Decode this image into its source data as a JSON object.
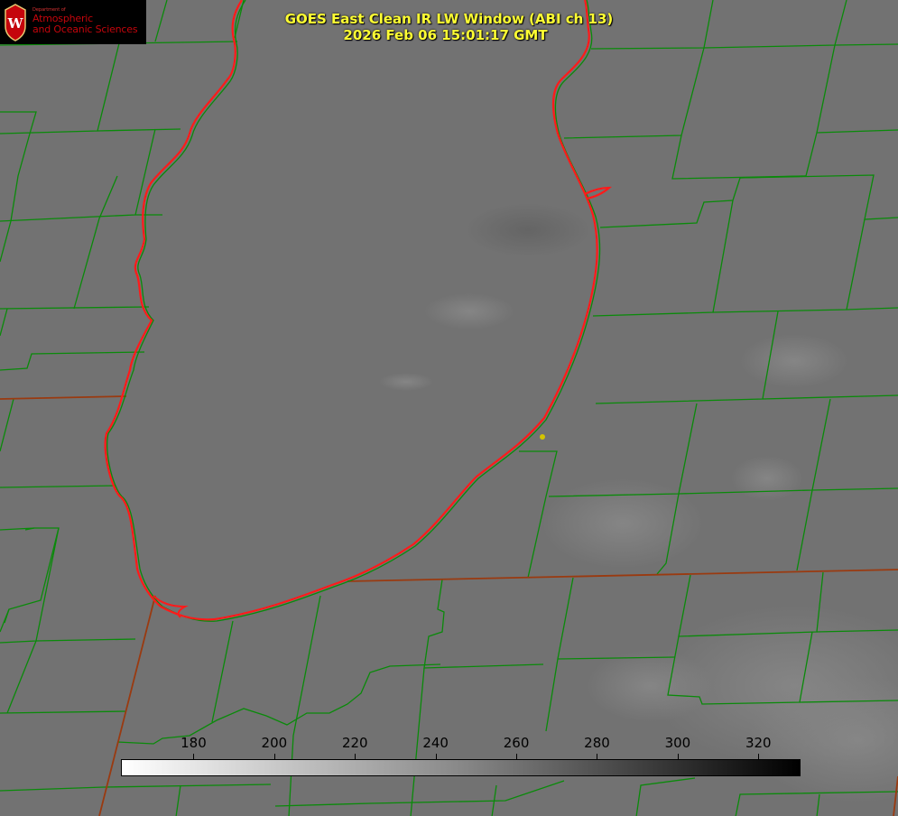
{
  "header": {
    "line1": "GOES East Clean IR LW Window (ABI ch 13)",
    "line2": "2026 Feb 06 15:01:17 GMT"
  },
  "logo": {
    "dept": "Department of",
    "line1": "Atmospheric",
    "line2": "and Oceanic Sciences",
    "seal_letter": "W"
  },
  "colorbar": {
    "min": 162,
    "max": 330,
    "labels": [
      "180",
      "200",
      "220",
      "240",
      "260",
      "280",
      "300",
      "320"
    ],
    "values": [
      180,
      200,
      220,
      240,
      260,
      280,
      300,
      320
    ]
  },
  "colors": {
    "background": "#727272",
    "county_lines": "#0a8a0a",
    "state_lines": "#9a3a10",
    "lake_outline": "#ff1a1a",
    "title_text": "#ffff33",
    "logo_red": "#c5050c",
    "marker": "#d4c400"
  }
}
